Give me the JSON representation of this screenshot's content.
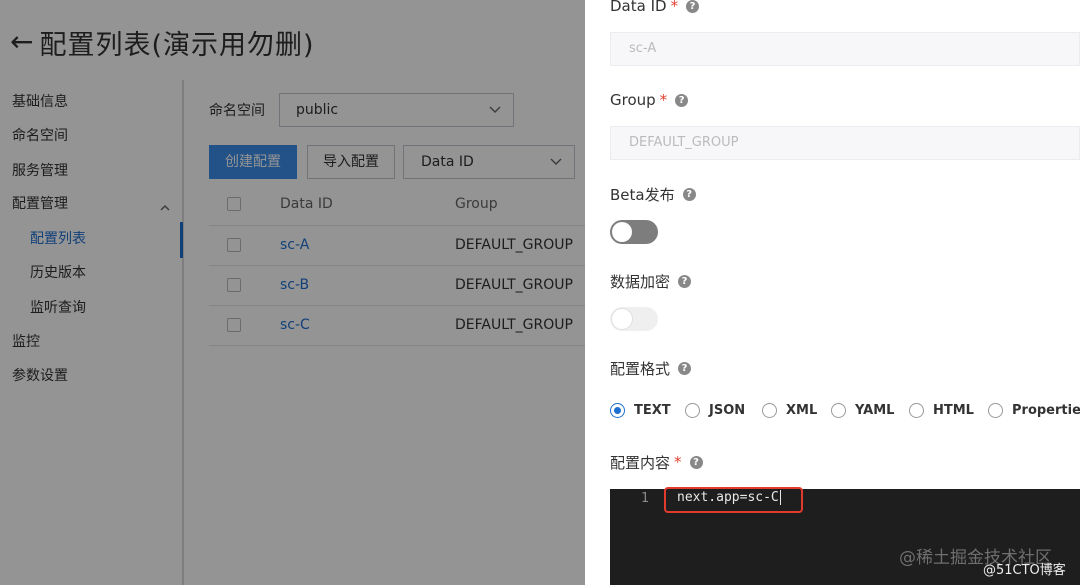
{
  "page": {
    "back_glyph": "←",
    "title": "配置列表(演示用勿删)"
  },
  "sidebar": {
    "items": [
      {
        "label": "基础信息"
      },
      {
        "label": "命名空间"
      },
      {
        "label": "服务管理"
      },
      {
        "label": "配置管理"
      },
      {
        "label": "配置列表",
        "active": true
      },
      {
        "label": "历史版本"
      },
      {
        "label": "监听查询"
      },
      {
        "label": "监控"
      },
      {
        "label": "参数设置"
      }
    ],
    "accent_color": "#1f6fd1"
  },
  "filters": {
    "namespace_label": "命名空间",
    "namespace_value": "public",
    "create_button": "创建配置",
    "import_button": "导入配置",
    "search_field_value": "Data ID"
  },
  "table": {
    "headers": [
      "Data ID",
      "Group"
    ],
    "rows": [
      {
        "data_id": "sc-A",
        "group": "DEFAULT_GROUP"
      },
      {
        "data_id": "sc-B",
        "group": "DEFAULT_GROUP"
      },
      {
        "data_id": "sc-C",
        "group": "DEFAULT_GROUP"
      }
    ]
  },
  "drawer": {
    "data_id_label": "Data ID",
    "data_id_value": "sc-A",
    "group_label": "Group",
    "group_value": "DEFAULT_GROUP",
    "beta_label": "Beta发布",
    "beta_enabled": true,
    "encrypt_label": "数据加密",
    "encrypt_enabled": false,
    "format_label": "配置格式",
    "formats": [
      "TEXT",
      "JSON",
      "XML",
      "YAML",
      "HTML",
      "Properties"
    ],
    "selected_format": "TEXT",
    "content_label": "配置内容",
    "required_mark": "*",
    "help_glyph": "?",
    "editor_line_number": "1",
    "editor_content": "next.app=sc-C"
  },
  "watermarks": {
    "primary": "@稀土掘金技术社区",
    "secondary": "@51CTO博客"
  }
}
